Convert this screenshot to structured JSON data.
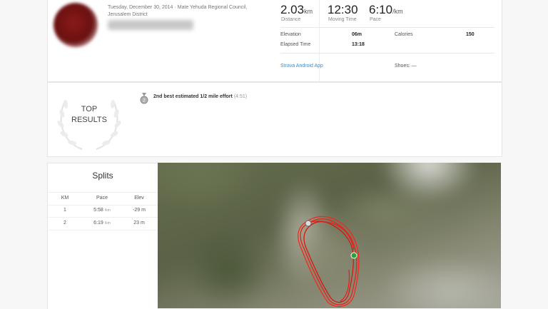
{
  "activity": {
    "date": "Tuesday, December 30, 2014 · Mate Yehuda Regional Council,",
    "location": "Jerusalem District"
  },
  "stats": {
    "distance": {
      "value": "2.03",
      "unit": "km",
      "label": "Distance"
    },
    "moving_time": {
      "value": "12:30",
      "label": "Moving Time"
    },
    "pace": {
      "value": "6:10",
      "unit": "/km",
      "label": "Pace"
    }
  },
  "details": {
    "elevation_label": "Elevation",
    "elevation_value": "06m",
    "calories_label": "Calories",
    "calories_value": "150",
    "elapsed_label": "Elapsed Time",
    "elapsed_value": "13:18",
    "device": "Strava Android App",
    "shoes": "Shoes: —"
  },
  "results": {
    "badge_line1": "TOP",
    "badge_line2": "RESULTS",
    "effort_text": "2nd best estimated 1/2 mile effort",
    "effort_time": "(4:51)"
  },
  "splits": {
    "title": "Splits",
    "headers": [
      "KM",
      "Pace",
      "Elev"
    ],
    "rows": [
      {
        "km": "1",
        "pace": "5:58",
        "pace_unit": "/km",
        "elev": "-29 m"
      },
      {
        "km": "2",
        "pace": "6:19",
        "pace_unit": "/km",
        "elev": "23 m"
      }
    ]
  },
  "colors": {
    "route": "#e8201a",
    "start_marker": "#2ca02c",
    "end_marker": "#dddddd",
    "link": "#4a8abf"
  },
  "icons": {
    "medal": "medal-icon",
    "laurel": "laurel-wreath-icon"
  }
}
